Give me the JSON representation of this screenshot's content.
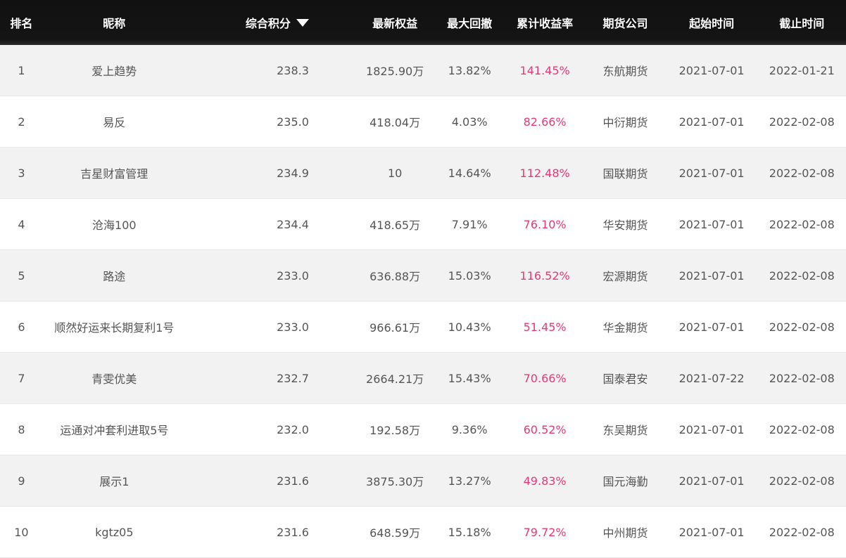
{
  "header": {
    "rank": "排名",
    "nickname": "昵称",
    "score": "综合积分",
    "score_sort_icon": "triangle-down-icon",
    "equity": "最新权益",
    "drawdown": "最大回撤",
    "return": "累计收益率",
    "company": "期货公司",
    "start": "起始时间",
    "end": "截止时间"
  },
  "colors": {
    "header_bg": "#111111",
    "return_color": "#e8377a",
    "stripe": "#f2f2f2"
  },
  "rows": [
    {
      "rank": "1",
      "nickname": "爱上趋势",
      "score": "238.3",
      "equity": "1825.90万",
      "drawdown": "13.82%",
      "return": "141.45%",
      "company": "东航期货",
      "start": "2021-07-01",
      "end": "2022-01-21"
    },
    {
      "rank": "2",
      "nickname": "易反",
      "score": "235.0",
      "equity": "418.04万",
      "drawdown": "4.03%",
      "return": "82.66%",
      "company": "中衍期货",
      "start": "2021-07-01",
      "end": "2022-02-08"
    },
    {
      "rank": "3",
      "nickname": "吉星财富管理",
      "score": "234.9",
      "equity": "10",
      "drawdown": "14.64%",
      "return": "112.48%",
      "company": "国联期货",
      "start": "2021-07-01",
      "end": "2022-02-08"
    },
    {
      "rank": "4",
      "nickname": "沧海100",
      "score": "234.4",
      "equity": "418.65万",
      "drawdown": "7.91%",
      "return": "76.10%",
      "company": "华安期货",
      "start": "2021-07-01",
      "end": "2022-02-08"
    },
    {
      "rank": "5",
      "nickname": "路途",
      "score": "233.0",
      "equity": "636.88万",
      "drawdown": "15.03%",
      "return": "116.52%",
      "company": "宏源期货",
      "start": "2021-07-01",
      "end": "2022-02-08"
    },
    {
      "rank": "6",
      "nickname": "顺然好运来长期复利1号",
      "score": "233.0",
      "equity": "966.61万",
      "drawdown": "10.43%",
      "return": "51.45%",
      "company": "华金期货",
      "start": "2021-07-01",
      "end": "2022-02-08"
    },
    {
      "rank": "7",
      "nickname": "青雯优美",
      "score": "232.7",
      "equity": "2664.21万",
      "drawdown": "15.43%",
      "return": "70.66%",
      "company": "国泰君安",
      "start": "2021-07-22",
      "end": "2022-02-08"
    },
    {
      "rank": "8",
      "nickname": "运通对冲套利进取5号",
      "score": "232.0",
      "equity": "192.58万",
      "drawdown": "9.36%",
      "return": "60.52%",
      "company": "东吴期货",
      "start": "2021-07-01",
      "end": "2022-02-08"
    },
    {
      "rank": "9",
      "nickname": "展示1",
      "score": "231.6",
      "equity": "3875.30万",
      "drawdown": "13.27%",
      "return": "49.83%",
      "company": "国元海勤",
      "start": "2021-07-01",
      "end": "2022-02-08"
    },
    {
      "rank": "10",
      "nickname": "kgtz05",
      "score": "231.6",
      "equity": "648.59万",
      "drawdown": "15.18%",
      "return": "79.72%",
      "company": "中州期货",
      "start": "2021-07-01",
      "end": "2022-02-08"
    }
  ]
}
